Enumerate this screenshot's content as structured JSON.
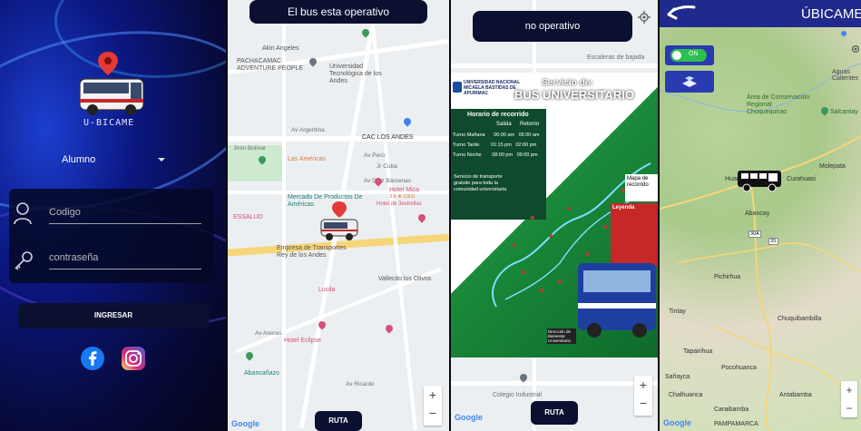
{
  "login": {
    "app_name": "U-BICAME",
    "role_selected": "Alumno",
    "code_placeholder": "Codigo",
    "password_placeholder": "contraseña",
    "submit_label": "INGRESAR",
    "social": [
      "facebook-icon",
      "instagram-icon"
    ]
  },
  "map1": {
    "status_banner": "El bus esta operativo",
    "route_button": "RUTA",
    "google_label": "Google",
    "places": [
      {
        "name": "Akin Angeles"
      },
      {
        "name": "PACHACAMAC ADVENTURE PEOPLE"
      },
      {
        "name": "Universidad Tecnológica de los Andes"
      },
      {
        "name": "CAC LOS ANDES"
      },
      {
        "name": "Las Américas"
      },
      {
        "name": "Mercado De Productos De Américas"
      },
      {
        "name": "Hotel Mica"
      },
      {
        "name": "Hotel de 3estrellas"
      },
      {
        "name": "ESSALUD"
      },
      {
        "name": "Empresa de Transportes Rey de los Andes"
      },
      {
        "name": "Vallecito los Olivos"
      },
      {
        "name": "Lucila"
      },
      {
        "name": "Hotel Eclipse"
      },
      {
        "name": "Abancañazo"
      }
    ],
    "streets": [
      "Av Argentina",
      "Av Perú",
      "Jirón Bolívar",
      "Jr Cuba",
      "Av Díaz Bárcenas",
      "Av Arenas",
      "Av Ricardo"
    ],
    "rating": "3.9 ★ (161)"
  },
  "map2": {
    "status_banner": "no operativo",
    "route_button": "RUTA",
    "google_label": "Google",
    "place_top": "Escaleras de bajada",
    "place_bottom": "Colegio Industrial",
    "poster": {
      "university": "UNIVERSIDAD NACIONAL MICAELA BASTIDAS DE APURIMAC",
      "service_label": "Servicio de:",
      "title": "BUS UNIVERSITARIO",
      "schedule_title": "Horario de recorrido",
      "col_out": "Salida",
      "col_return": "Retorno",
      "rows": [
        {
          "turno": "Turno Mañana",
          "salida": "06:00 am",
          "retorno": "06:00 am"
        },
        {
          "turno": "Turno Tarde",
          "salida": "01:15 pm",
          "retorno": "02:00 pm"
        },
        {
          "turno": "Turno Noche",
          "salida": "08:00 pm",
          "retorno": "09:00 pm"
        }
      ],
      "free_text": "Servicio de transporte gratuito para toda la comunidad universitaria",
      "map_label": "Mapa de recorrido",
      "leyenda": "Leyenda",
      "direction": "Dirección de Bienestar Universitario"
    }
  },
  "map3": {
    "title": "ÚBICAME",
    "toggle_label": "ON",
    "places": [
      {
        "name": "Aguas Calientes"
      },
      {
        "name": "Área de Conservación Regional Choquequirao"
      },
      {
        "name": "Salcantay"
      },
      {
        "name": "Molepata"
      },
      {
        "name": "Huanipaca"
      },
      {
        "name": "Curahuasi"
      },
      {
        "name": "Abancay"
      },
      {
        "name": "Pichirhua"
      },
      {
        "name": "Tintay"
      },
      {
        "name": "Chuquibambilla"
      },
      {
        "name": "Tapairihua"
      },
      {
        "name": "Pocohuanca"
      },
      {
        "name": "Sañayca"
      },
      {
        "name": "Chalhuanca"
      },
      {
        "name": "Caraibamba"
      },
      {
        "name": "Antabamba"
      },
      {
        "name": "PAMPAMARCA"
      }
    ],
    "route_shields": [
      "30A",
      "3S"
    ],
    "google_label": "Google"
  }
}
